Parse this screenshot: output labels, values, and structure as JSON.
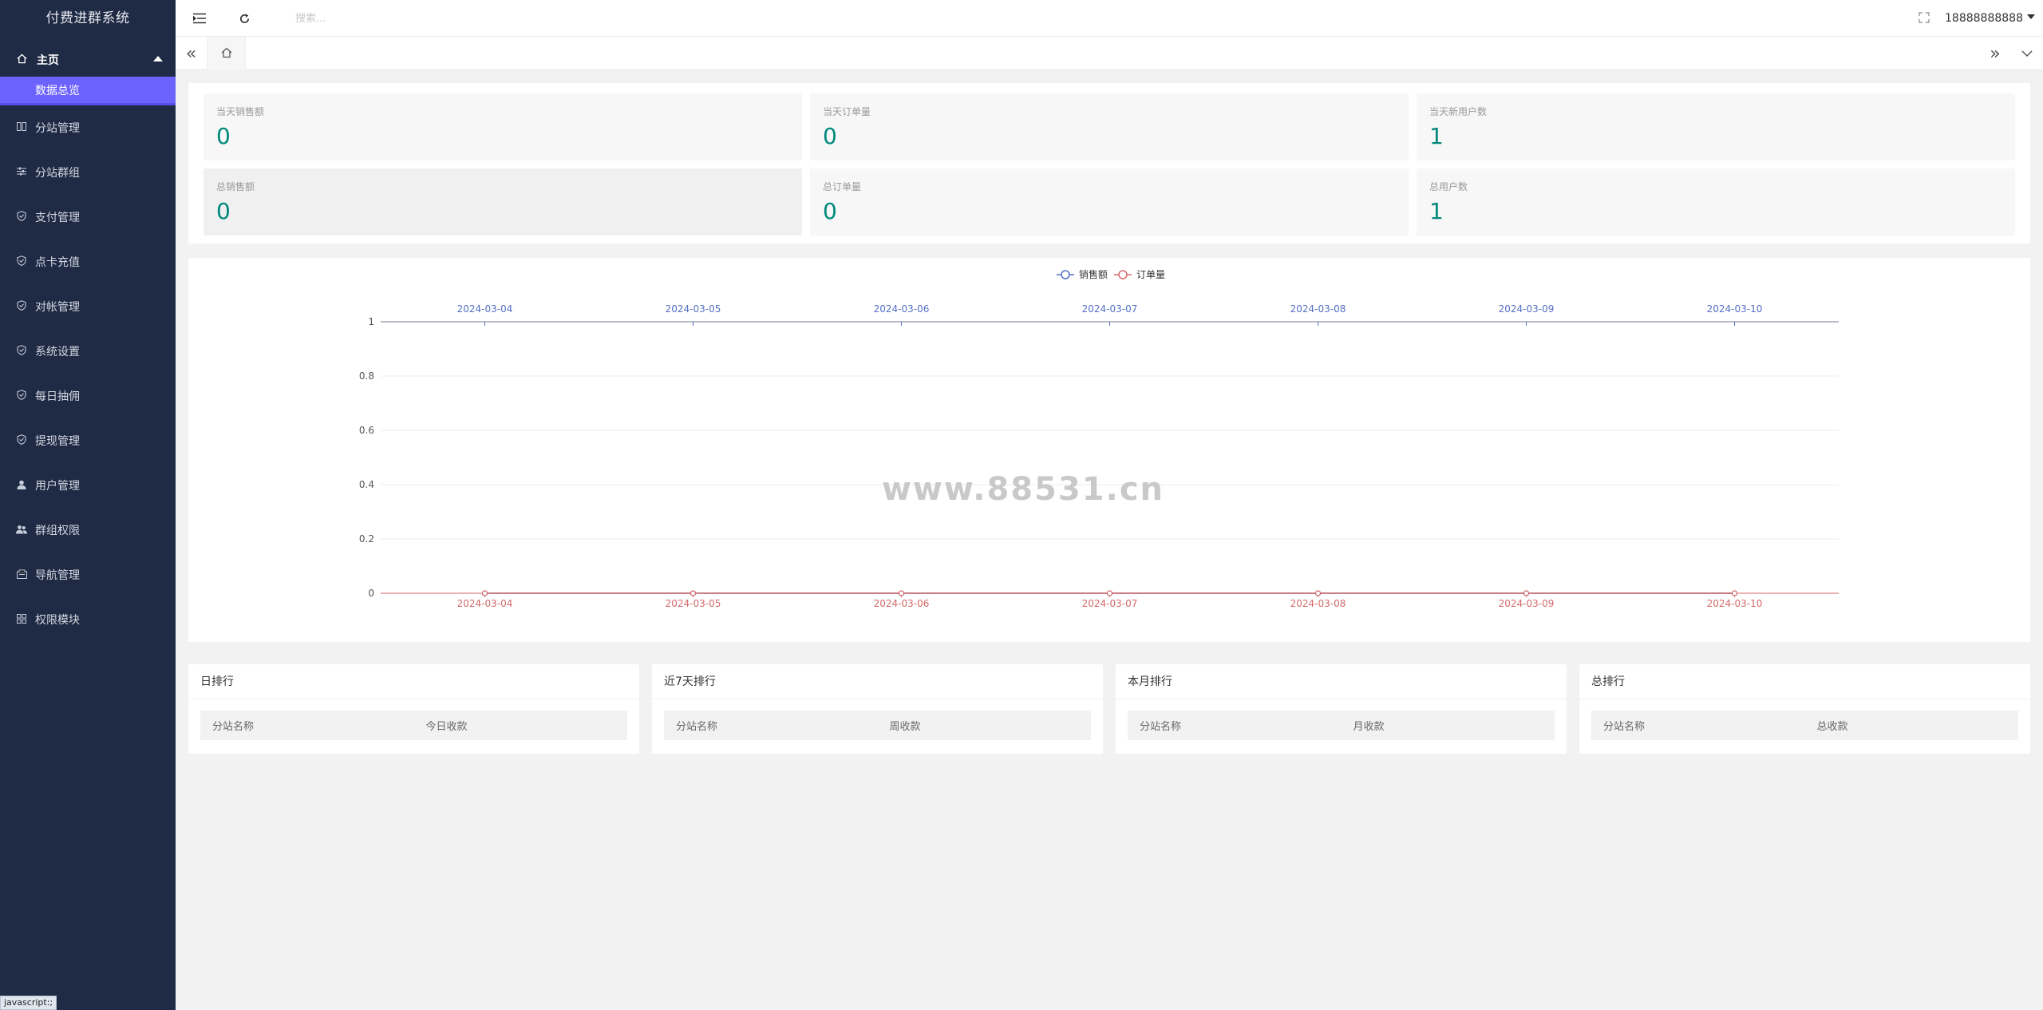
{
  "app": {
    "title": "付费进群系统"
  },
  "sidebar": {
    "home": {
      "label": "主页",
      "icon": "home-icon"
    },
    "active_sub": "数据总览",
    "items": [
      {
        "label": "分站管理",
        "icon": "columns-icon"
      },
      {
        "label": "分站群组",
        "icon": "sliders-icon"
      },
      {
        "label": "支付管理",
        "icon": "shield-check-icon"
      },
      {
        "label": "点卡充值",
        "icon": "shield-check-icon"
      },
      {
        "label": "对帐管理",
        "icon": "shield-check-icon"
      },
      {
        "label": "系统设置",
        "icon": "shield-check-icon"
      },
      {
        "label": "每日抽佣",
        "icon": "shield-check-icon"
      },
      {
        "label": "提现管理",
        "icon": "shield-check-icon"
      },
      {
        "label": "用户管理",
        "icon": "user-icon"
      },
      {
        "label": "群组权限",
        "icon": "group-icon"
      },
      {
        "label": "导航管理",
        "icon": "nav-icon"
      },
      {
        "label": "权限模块",
        "icon": "grid-icon"
      }
    ]
  },
  "topbar": {
    "search_placeholder": "搜索...",
    "user": "18888888888"
  },
  "stats": [
    {
      "label": "当天销售额",
      "value": "0"
    },
    {
      "label": "当天订单量",
      "value": "0"
    },
    {
      "label": "当天新用户数",
      "value": "1"
    },
    {
      "label": "总销售额",
      "value": "0"
    },
    {
      "label": "总订单量",
      "value": "0"
    },
    {
      "label": "总用户数",
      "value": "1"
    }
  ],
  "colors": {
    "accent": "#6c63ff",
    "sidebar": "#1f2a44",
    "stat_value": "#00897b",
    "series_sales": "#5470c6",
    "series_orders": "#d46a6a"
  },
  "chart_data": {
    "type": "line",
    "categories": [
      "2024-03-04",
      "2024-03-05",
      "2024-03-06",
      "2024-03-07",
      "2024-03-08",
      "2024-03-09",
      "2024-03-10"
    ],
    "series": [
      {
        "name": "销售额",
        "values": [
          0,
          0,
          0,
          0,
          0,
          0,
          0
        ]
      },
      {
        "name": "订单量",
        "values": [
          0,
          0,
          0,
          0,
          0,
          0,
          0
        ]
      }
    ],
    "y_ticks": [
      "1",
      "0.8",
      "0.6",
      "0.4",
      "0.2",
      "0"
    ],
    "ylim": [
      0,
      1
    ],
    "legend": "top-center",
    "grid": true
  },
  "watermark": "www.88531.cn",
  "rankings": [
    {
      "title": "日排行",
      "col1": "分站名称",
      "col2": "今日收款"
    },
    {
      "title": "近7天排行",
      "col1": "分站名称",
      "col2": "周收款"
    },
    {
      "title": "本月排行",
      "col1": "分站名称",
      "col2": "月收款"
    },
    {
      "title": "总排行",
      "col1": "分站名称",
      "col2": "总收款"
    }
  ],
  "status_bar": "javascript:;"
}
